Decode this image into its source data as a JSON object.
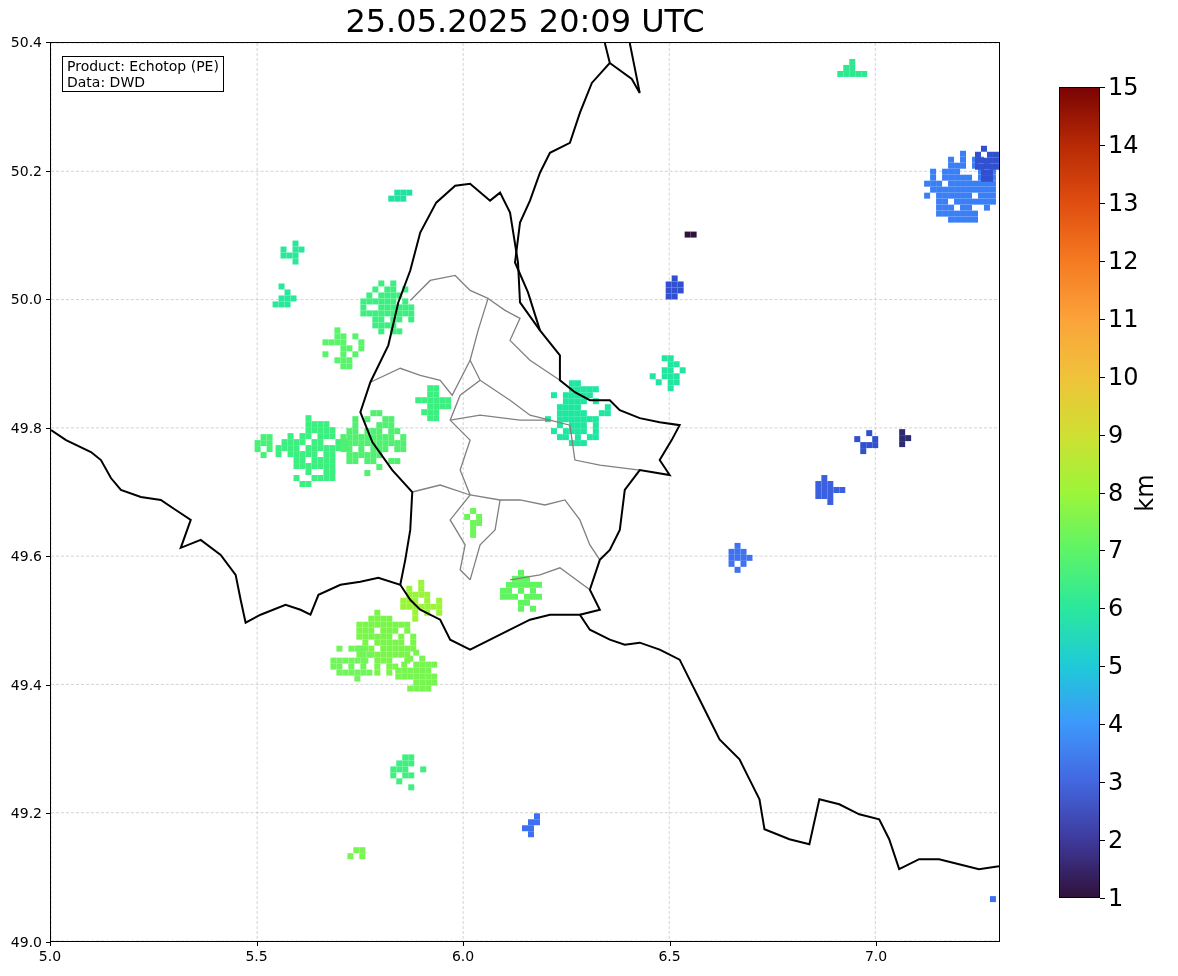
{
  "title": "25.05.2025 20:09 UTC",
  "info_box": {
    "lines": [
      "Product: Echotop (PE)",
      "Data: DWD"
    ]
  },
  "map": {
    "xticks": [
      "5.0",
      "5.5",
      "6.0",
      "6.5",
      "7.0"
    ],
    "yticks": [
      "50.4",
      "50.2",
      "50.0",
      "49.8",
      "49.6",
      "49.4",
      "49.2",
      "49.0"
    ]
  },
  "colorbar": {
    "label": "km",
    "ticks": [
      "15",
      "14",
      "13",
      "12",
      "11",
      "10",
      "9",
      "8",
      "7",
      "6",
      "5",
      "4",
      "3",
      "2",
      "1"
    ]
  }
}
